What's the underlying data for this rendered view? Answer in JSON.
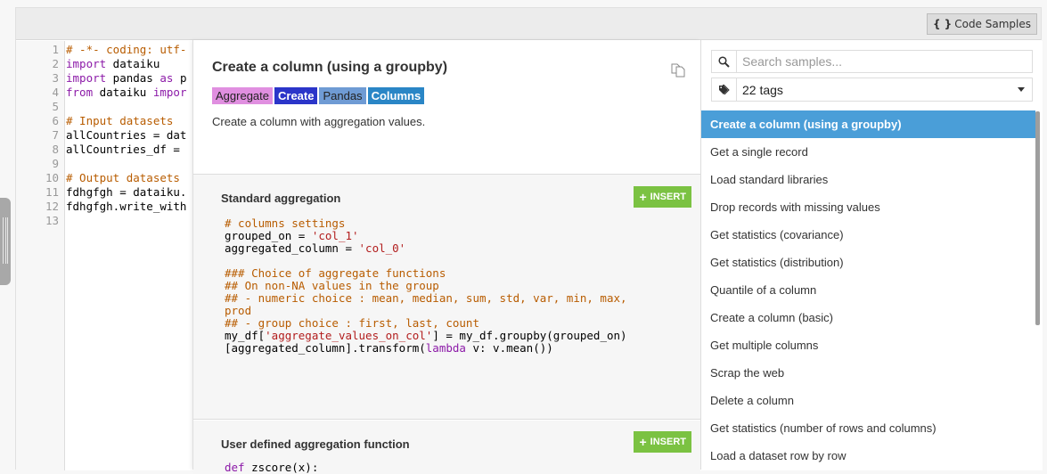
{
  "toolbar": {
    "code_samples_icon": "{ }",
    "code_samples_label": "Code Samples"
  },
  "editor": {
    "lines": [
      {
        "n": "1",
        "parts": [
          {
            "c": "cm",
            "t": "# -*- coding: utf-"
          }
        ]
      },
      {
        "n": "2",
        "parts": [
          {
            "c": "kw",
            "t": "import"
          },
          {
            "c": "",
            "t": " dataiku"
          }
        ]
      },
      {
        "n": "3",
        "parts": [
          {
            "c": "kw",
            "t": "import"
          },
          {
            "c": "",
            "t": " pandas "
          },
          {
            "c": "kw",
            "t": "as"
          },
          {
            "c": "",
            "t": " p"
          }
        ]
      },
      {
        "n": "4",
        "parts": [
          {
            "c": "kw",
            "t": "from"
          },
          {
            "c": "",
            "t": " dataiku "
          },
          {
            "c": "kw",
            "t": "impor"
          }
        ]
      },
      {
        "n": "5",
        "parts": []
      },
      {
        "n": "6",
        "parts": [
          {
            "c": "cm",
            "t": "# Input datasets"
          }
        ]
      },
      {
        "n": "7",
        "parts": [
          {
            "c": "",
            "t": "allCountries = dat"
          }
        ]
      },
      {
        "n": "8",
        "parts": [
          {
            "c": "",
            "t": "allCountries_df = "
          }
        ]
      },
      {
        "n": "9",
        "parts": []
      },
      {
        "n": "10",
        "parts": [
          {
            "c": "cm",
            "t": "# Output datasets"
          }
        ]
      },
      {
        "n": "11",
        "parts": [
          {
            "c": "",
            "t": "fdhgfgh = dataiku."
          }
        ]
      },
      {
        "n": "12",
        "parts": [
          {
            "c": "",
            "t": "fdhgfgh.write_with"
          }
        ]
      },
      {
        "n": "13",
        "parts": []
      }
    ]
  },
  "detail": {
    "title": "Create a column (using a groupby)",
    "copy_icon": "copy-icon",
    "tags": [
      {
        "label": "Aggregate",
        "bg": "#e08fe0",
        "fg": "#222222"
      },
      {
        "label": "Create",
        "bg": "#2b35c9",
        "fg": "#ffffff"
      },
      {
        "label": "Pandas",
        "bg": "#6f9bd4",
        "fg": "#222222"
      },
      {
        "label": "Columns",
        "bg": "#2a86c6",
        "fg": "#ffffff"
      }
    ],
    "description": "Create a column with aggregation values.",
    "sections": [
      {
        "title": "Standard aggregation",
        "insert_label": "INSERT",
        "code": [
          [
            {
              "c": "cm",
              "t": "# columns settings"
            }
          ],
          [
            {
              "c": "",
              "t": "grouped_on = "
            },
            {
              "c": "st",
              "t": "'col_1'"
            }
          ],
          [
            {
              "c": "",
              "t": "aggregated_column = "
            },
            {
              "c": "st",
              "t": "'col_0'"
            }
          ],
          [],
          [
            {
              "c": "cm",
              "t": "### Choice of aggregate functions"
            }
          ],
          [
            {
              "c": "cm",
              "t": "## On non-NA values in the group"
            }
          ],
          [
            {
              "c": "cm",
              "t": "## - numeric choice : mean, median, sum, std, var, min, max,"
            }
          ],
          [
            {
              "c": "cm",
              "t": "prod"
            }
          ],
          [
            {
              "c": "cm",
              "t": "## - group choice : first, last, count"
            }
          ],
          [
            {
              "c": "",
              "t": "my_df["
            },
            {
              "c": "st",
              "t": "'aggregate_values_on_col'"
            },
            {
              "c": "",
              "t": "] = my_df.groupby(grouped_on)"
            }
          ],
          [
            {
              "c": "",
              "t": "[aggregated_column].transform("
            },
            {
              "c": "kw",
              "t": "lambda"
            },
            {
              "c": "",
              "t": " v: v.mean())"
            }
          ]
        ]
      },
      {
        "title": "User defined aggregation function",
        "insert_label": "INSERT",
        "code": [
          [
            {
              "c": "kw",
              "t": "def"
            },
            {
              "c": "",
              "t": " zscore(x):"
            }
          ]
        ]
      }
    ]
  },
  "sidebar": {
    "search": {
      "value": "",
      "placeholder": "Search samples..."
    },
    "tags_filter": {
      "value": "22 tags"
    },
    "items": [
      {
        "label": "Create a column (using a groupby)",
        "active": true
      },
      {
        "label": "Get a single record",
        "active": false
      },
      {
        "label": "Load standard libraries",
        "active": false
      },
      {
        "label": "Drop records with missing values",
        "active": false
      },
      {
        "label": "Get statistics (covariance)",
        "active": false
      },
      {
        "label": "Get statistics (distribution)",
        "active": false
      },
      {
        "label": "Quantile of a column",
        "active": false
      },
      {
        "label": "Create a column (basic)",
        "active": false
      },
      {
        "label": "Get multiple columns",
        "active": false
      },
      {
        "label": "Scrap the web",
        "active": false
      },
      {
        "label": "Delete a column",
        "active": false
      },
      {
        "label": "Get statistics (number of rows and columns)",
        "active": false
      },
      {
        "label": "Load a dataset row by row",
        "active": false
      }
    ]
  }
}
